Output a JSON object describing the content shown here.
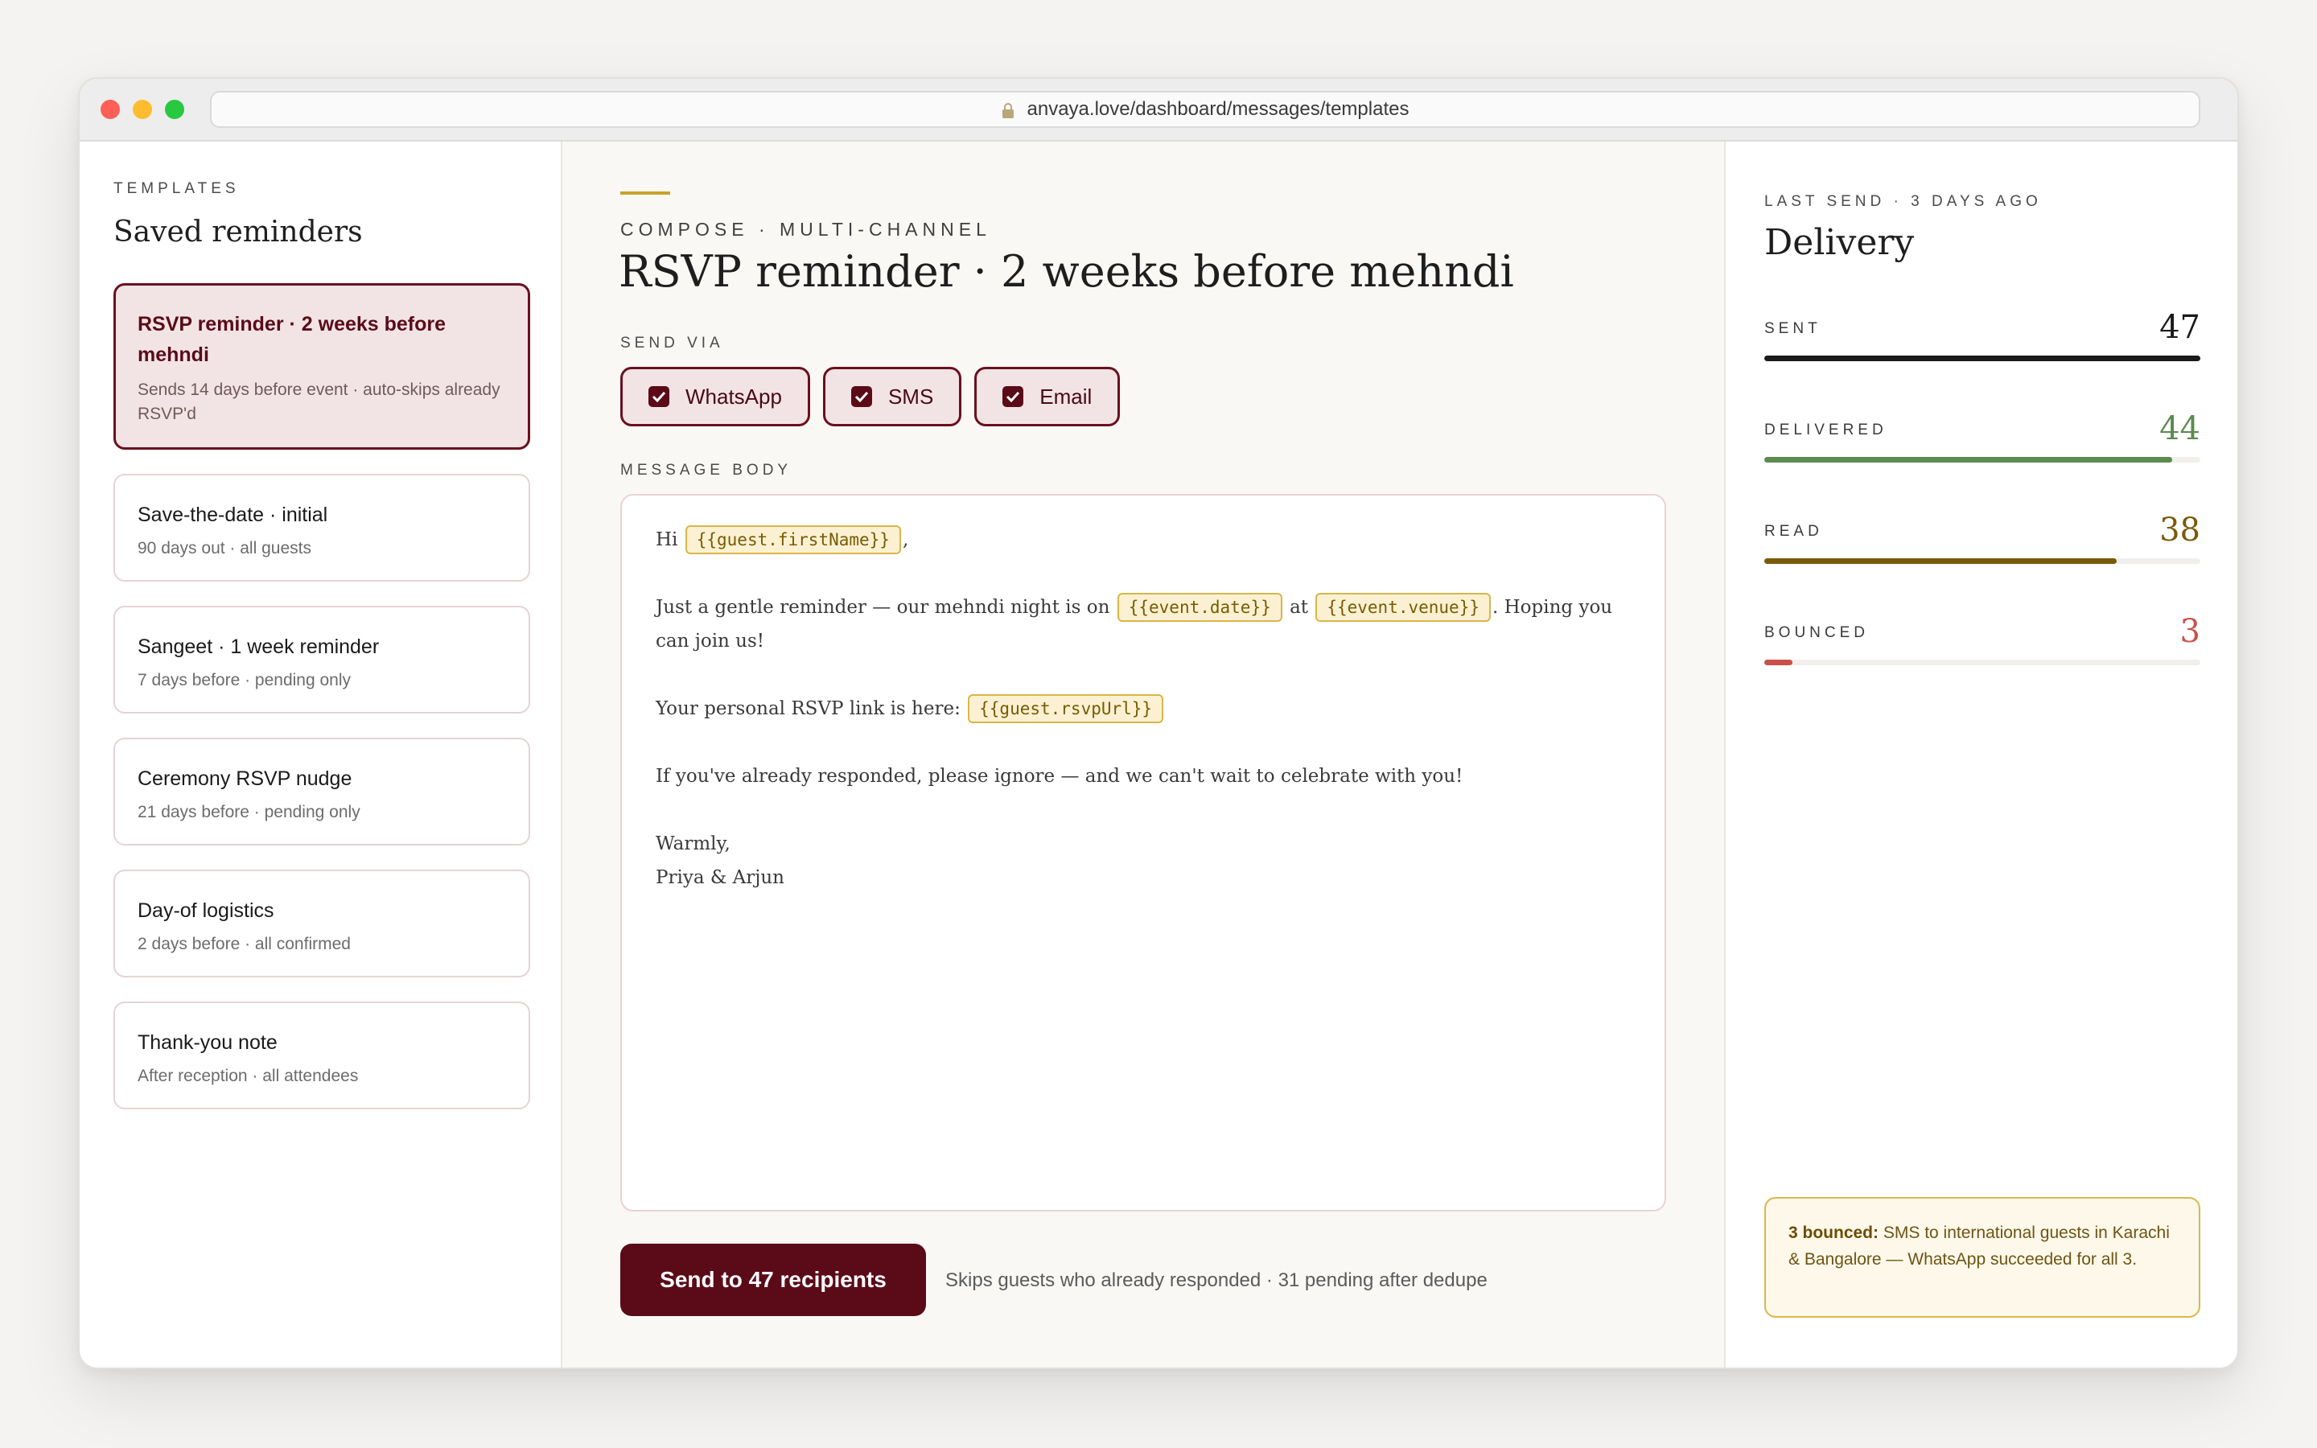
{
  "browser": {
    "url": "anvaya.love/dashboard/messages/templates"
  },
  "sidebar": {
    "eyebrow": "TEMPLATES",
    "title": "Saved reminders",
    "templates": [
      {
        "name": "RSVP reminder · 2 weeks before mehndi",
        "desc": "Sends 14 days before event · auto-skips already RSVP'd",
        "active": true
      },
      {
        "name": "Save-the-date · initial",
        "desc": "90 days out · all guests"
      },
      {
        "name": "Sangeet · 1 week reminder",
        "desc": "7 days before · pending only"
      },
      {
        "name": "Ceremony RSVP nudge",
        "desc": "21 days before · pending only"
      },
      {
        "name": "Day-of logistics",
        "desc": "2 days before · all confirmed"
      },
      {
        "name": "Thank-you note",
        "desc": "After reception · all attendees"
      }
    ]
  },
  "compose": {
    "eyebrow": "COMPOSE · MULTI-CHANNEL",
    "title": "RSVP reminder · 2 weeks before mehndi",
    "send_via_label": "SEND VIA",
    "channels": [
      {
        "label": "WhatsApp",
        "checked": true
      },
      {
        "label": "SMS",
        "checked": true
      },
      {
        "label": "Email",
        "checked": true
      }
    ],
    "body_label": "MESSAGE BODY",
    "body": {
      "greeting": "Hi",
      "token_first_name": "{{guest.firstName}}",
      "greeting_end": ",",
      "line2_a": "Just a gentle reminder — our mehndi night is on",
      "token_date": "{{event.date}}",
      "line2_at": "at",
      "token_venue": "{{event.venue}}",
      "line2_b": ". Hoping you can join us!",
      "line3_a": "Your personal RSVP link is here:",
      "token_rsvp": "{{guest.rsvpUrl}}",
      "line4": "If you've already responded, please ignore — and we can't wait to celebrate with you!",
      "signoff": "Warmly,",
      "signature": "Priya & Arjun"
    },
    "send_button": "Send to 47 recipients",
    "send_note": "Skips guests who already responded · 31 pending after dedupe"
  },
  "delivery": {
    "eyebrow": "LAST SEND · 3 DAYS AGO",
    "title": "Delivery",
    "stats": [
      {
        "label": "SENT",
        "value": "47",
        "fraction": 1.0,
        "color": "#1a1a1a"
      },
      {
        "label": "DELIVERED",
        "value": "44",
        "fraction": 0.936,
        "color": "#5c8a4f"
      },
      {
        "label": "READ",
        "value": "38",
        "fraction": 0.809,
        "color": "#7a5a0a"
      },
      {
        "label": "BOUNCED",
        "value": "3",
        "fraction": 0.064,
        "color": "#c9504a"
      }
    ],
    "notice_bold": "3 bounced:",
    "notice_text": " SMS to international guests in Karachi & Bangalore — WhatsApp succeeded for all 3."
  },
  "colors": {
    "brand": "#5b0b18",
    "accent_gold": "#c9a227"
  }
}
